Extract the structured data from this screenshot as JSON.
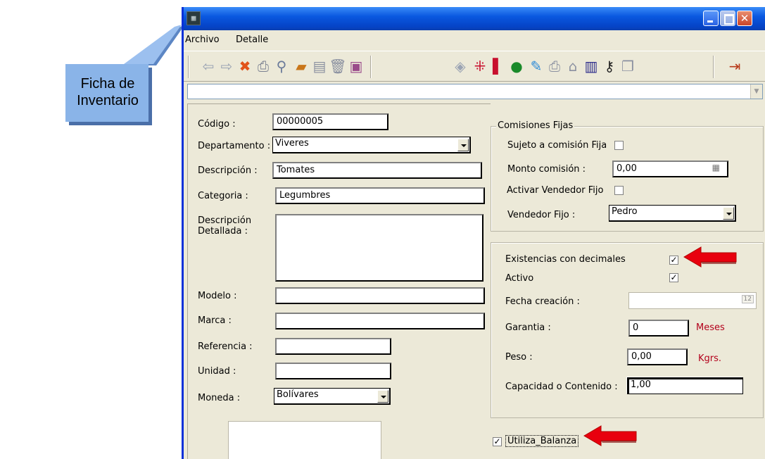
{
  "callout": {
    "line1": "Ficha de",
    "line2": "Inventario",
    "fill": "#8ab4e8"
  },
  "window": {
    "menu": [
      "Archivo",
      "Detalle"
    ],
    "toolbar_icons": [
      "back-arrow-icon",
      "forward-arrow-icon",
      "delete-x-icon",
      "print-icon",
      "search-icon",
      "open-folder-icon",
      "edit-icon",
      "trash-icon",
      "save-icon",
      "tag-icon",
      "grid-icon",
      "barcode-icon",
      "dollar-icon",
      "pencil-icon",
      "printer2-icon",
      "house-icon",
      "chart-icon",
      "keys-icon",
      "copy-icon",
      "exit-icon"
    ]
  },
  "form": {
    "codigo_label": "Código :",
    "codigo_value": "00000005",
    "departamento_label": "Departamento :",
    "departamento_value": "Viveres",
    "descripcion_label": "Descripción :",
    "descripcion_value": "Tomates",
    "categoria_label": "Categoria :",
    "categoria_value": "Legumbres",
    "desc_det_label_1": "Descripción",
    "desc_det_label_2": "Detallada :",
    "desc_det_value": "",
    "modelo_label": "Modelo :",
    "modelo_value": "",
    "marca_label": "Marca :",
    "marca_value": "",
    "referencia_label": "Referencia :",
    "referencia_value": "",
    "unidad_label": "Unidad :",
    "unidad_value": "",
    "moneda_label": "Moneda :",
    "moneda_value": "Bolívares"
  },
  "comisiones": {
    "title": "Comisiones Fijas",
    "sujeto_label": "Sujeto a comisión Fija",
    "sujeto_checked": false,
    "monto_label": "Monto comisión :",
    "monto_value": "0,00",
    "activar_label": "Activar Vendedor Fijo",
    "activar_checked": false,
    "vendedor_label": "Vendedor Fijo :",
    "vendedor_value": "Pedro"
  },
  "opciones": {
    "existencias_label": "Existencias con decimales",
    "existencias_mark": "✓",
    "activo_label": "Activo",
    "activo_mark": "✓",
    "fecha_label": "Fecha creación :",
    "fecha_value": "",
    "garantia_label": "Garantia :",
    "garantia_value": "0",
    "garantia_unit": "Meses",
    "peso_label": "Peso :",
    "peso_value": "0,00",
    "peso_unit": "Kgrs.",
    "capacidad_label": "Capacidad o Contenido :",
    "capacidad_value": "1,00",
    "balanza_label": "Utiliza_Balanza",
    "balanza_mark": "✓"
  },
  "colors": {
    "arrow": "#e8000e",
    "titlebar": "#0a58e0",
    "window_bg": "#ece9d8"
  }
}
